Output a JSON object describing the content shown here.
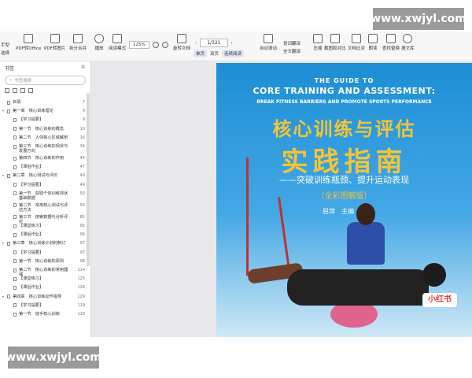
{
  "watermark": "www.xwjyl.com",
  "toolbar": {
    "buttons": [
      "PDF转Office",
      "PDF转图片",
      "拆分合并",
      "播放",
      "阅读模式",
      "旋转文档",
      "单页",
      "双页",
      "连续阅读",
      "自动滚动",
      "划词翻译",
      "全文翻译",
      "压缩",
      "截图和对比",
      "文档比对",
      "朗读",
      "查找替换",
      "搜文库"
    ],
    "zoom": "125%",
    "page": "1/321",
    "left_labels": [
      "手型",
      "选择"
    ]
  },
  "sidebar": {
    "title": "书签",
    "search_placeholder": "书签搜索",
    "toc": [
      {
        "label": "目录",
        "page": "7",
        "level": 0,
        "expand": false
      },
      {
        "label": "第一章　核心训练理论",
        "page": "9",
        "level": 0,
        "expand": true
      },
      {
        "label": "【学习提要】",
        "page": "9",
        "level": 1
      },
      {
        "label": "第一节　核心训练的概念",
        "page": "10",
        "level": 1
      },
      {
        "label": "第二节　人体核心区域解剖",
        "page": "16",
        "level": 1
      },
      {
        "label": "第三节　核心训练的现状与发展方向",
        "page": "34",
        "level": 1
      },
      {
        "label": "第四节　核心训练的作用",
        "page": "44",
        "level": 1
      },
      {
        "label": "【课后作业】",
        "page": "47",
        "level": 1
      },
      {
        "label": "第二章　核心测试与评价",
        "page": "49",
        "level": 0,
        "expand": true
      },
      {
        "label": "【学习提要】",
        "page": "49",
        "level": 1
      },
      {
        "label": "第一节　获取个体训练现状基础数据",
        "page": "50",
        "level": 1
      },
      {
        "label": "第二节　常用核心测试与评估方法",
        "page": "56",
        "level": 1
      },
      {
        "label": "第三节　搜索数据与分析评价",
        "page": "85",
        "level": 1
      },
      {
        "label": "【课堂练习】",
        "page": "95",
        "level": 1
      },
      {
        "label": "【课后作业】",
        "page": "96",
        "level": 1
      },
      {
        "label": "第三章　核心训练计划的制订",
        "page": "97",
        "level": 0,
        "expand": true
      },
      {
        "label": "【学习提要】",
        "page": "97",
        "level": 1
      },
      {
        "label": "第一节　核心训练的原则",
        "page": "98",
        "level": 1
      },
      {
        "label": "第二节　核心训练的常用器械",
        "page": "114",
        "level": 1
      },
      {
        "label": "【课堂练习】",
        "page": "125",
        "level": 1
      },
      {
        "label": "【课后作业】",
        "page": "126",
        "level": 1
      },
      {
        "label": "第四章　核心训练动作指导",
        "page": "129",
        "level": 0,
        "expand": true
      },
      {
        "label": "【学习提要】",
        "page": "129",
        "level": 1
      },
      {
        "label": "第一节　徒手核心训练",
        "page": "130",
        "level": 1
      }
    ]
  },
  "cover": {
    "en_line1": "THE GUIDE TO",
    "en_line2": "CORE TRAINING AND ASSESSMENT:",
    "en_line3": "BREAK FITNESS BARRIERS AND PROMOTE SPORTS PERFORMANCE",
    "cn_line1": "核心训练与评估",
    "cn_line2": "实践指南",
    "subtitle": "——突破训练瓶颈、提升运动表现",
    "edition": "（全彩图解版）",
    "author": "屈萍　主编",
    "logo": "小红书",
    "colors": {
      "background": "#1d8ed4",
      "title": "#f4c436"
    }
  }
}
